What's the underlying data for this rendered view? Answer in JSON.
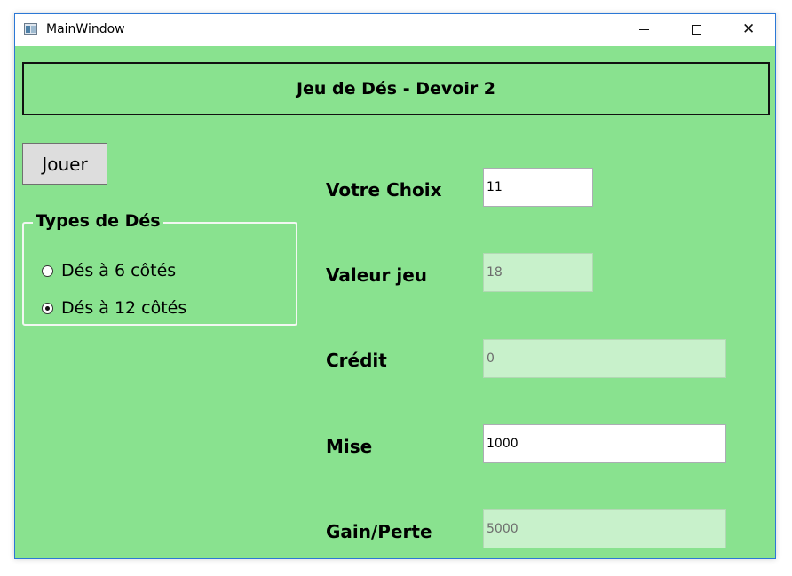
{
  "window": {
    "title": "MainWindow"
  },
  "header": {
    "title": "Jeu de Dés - Devoir 2"
  },
  "controls": {
    "play_label": "Jouer"
  },
  "dice_group": {
    "legend": "Types de Dés",
    "options": [
      {
        "label": "Dés à 6 côtés",
        "checked": false
      },
      {
        "label": "Dés à 12 côtés",
        "checked": true
      }
    ]
  },
  "fields": {
    "choice": {
      "label": "Votre Choix",
      "value": "11",
      "enabled": true
    },
    "game_value": {
      "label": "Valeur jeu",
      "value": "18",
      "enabled": false
    },
    "credit": {
      "label": "Crédit",
      "value": "0",
      "enabled": false
    },
    "bet": {
      "label": "Mise",
      "value": "1000",
      "enabled": true
    },
    "gain_loss": {
      "label": "Gain/Perte",
      "value": "5000",
      "enabled": false
    }
  },
  "colors": {
    "background": "#89e28f",
    "disabled_field": "#c8f1cb",
    "enabled_field": "#ffffff"
  }
}
